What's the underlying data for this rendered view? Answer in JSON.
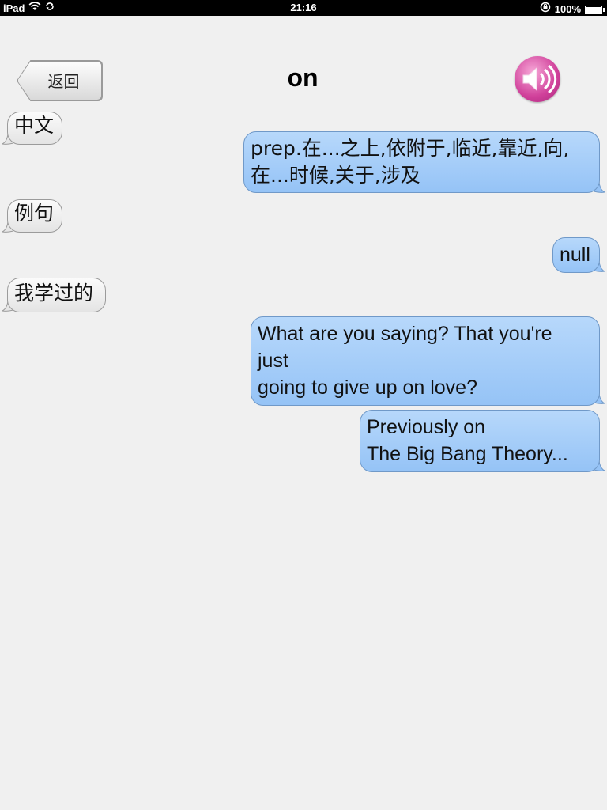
{
  "status_bar": {
    "device": "iPad",
    "time": "21:16",
    "battery": "100%"
  },
  "nav": {
    "back_label": "返回",
    "title": "on"
  },
  "messages": [
    {
      "side": "left",
      "text": "中文"
    },
    {
      "side": "right",
      "text": "prep.在...之上,依附于,临近,靠近,向,\n在...时候,关于,涉及"
    },
    {
      "side": "left",
      "text": "例句"
    },
    {
      "side": "right",
      "text": "null"
    },
    {
      "side": "left",
      "text": "我学过的"
    },
    {
      "side": "right",
      "text": "What are you saying? That you're\njust\ngoing to give up on love?"
    },
    {
      "side": "right",
      "text": "Previously on\nThe Big Bang Theory..."
    }
  ],
  "colors": {
    "status_bar_bg": "#000000",
    "page_bg": "#f0f0f0",
    "blue_bubble": "#a5cdf8",
    "gray_bubble": "#efefef",
    "speaker_pink": "#d0409a"
  },
  "icons": [
    "wifi-icon",
    "sync-icon",
    "rotation-lock-icon",
    "battery-icon",
    "speaker-icon"
  ]
}
